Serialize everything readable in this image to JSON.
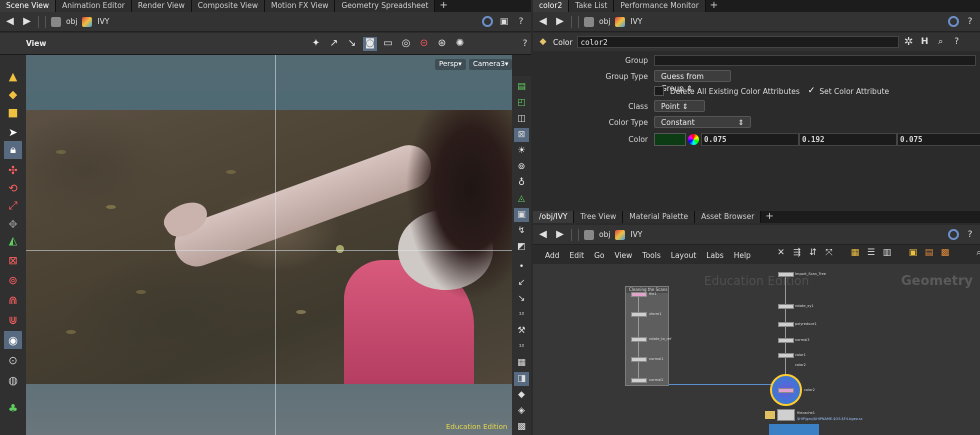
{
  "left_tabs": [
    "Scene View",
    "Animation Editor",
    "Render View",
    "Composite View",
    "Motion FX View",
    "Geometry Spreadsheet"
  ],
  "right_top_tabs": [
    "color2",
    "Take List",
    "Performance Monitor"
  ],
  "right_bottom_tabs": [
    "/obj/IVY",
    "Tree View",
    "Material Palette",
    "Asset Browser"
  ],
  "left_path": {
    "context": "obj",
    "node": "IVY"
  },
  "right_top_path": {
    "context": "obj",
    "node": "IVY"
  },
  "right_bottom_path": {
    "context": "obj",
    "node": "IVY"
  },
  "viewport": {
    "label": "View",
    "persp_label": "Persp▾",
    "camera_label": "Camera3▾",
    "watermark": "Education Edition"
  },
  "params": {
    "node_type": "Color",
    "node_name": "color2",
    "group_label": "Group",
    "group_value": "",
    "group_type_label": "Group Type",
    "group_type_value": "Guess from Group",
    "delete_attr_label": "Delete All Existing Color Attributes",
    "set_attr_label": "Set Color Attribute",
    "set_attr_checked": true,
    "class_label": "Class",
    "class_value": "Point",
    "color_type_label": "Color Type",
    "color_type_value": "Constant",
    "color_label": "Color",
    "color_r": "0.075",
    "color_g": "0.192",
    "color_b": "0.075",
    "color_swatch": "#0c3c13"
  },
  "network_menu": [
    "Add",
    "Edit",
    "Go",
    "View",
    "Tools",
    "Layout",
    "Labs",
    "Help"
  ],
  "network": {
    "watermark": "Education Edition",
    "context_label": "Geometry",
    "box_title": "Cleaning the Scans",
    "nodes_left": [
      "file1",
      "xform1",
      "rotate_to_ref",
      "normal1",
      "normal2"
    ],
    "nodes_right": [
      "Import_Scan_Tree",
      "rotate_xy1",
      "polyreduce1",
      "normal3",
      "color1",
      "color2"
    ],
    "node_selected": "color2",
    "node_bottom": "filecache1",
    "node_bottom_sub": "$HIP/geo/$HIPNAME.$OS.$F4.bgeo.sc"
  }
}
